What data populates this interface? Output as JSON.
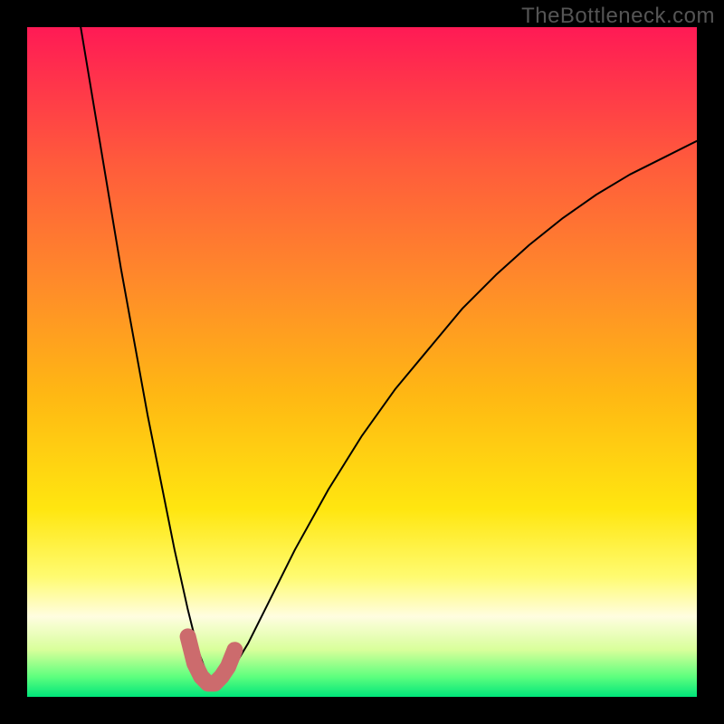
{
  "watermark": "TheBottleneck.com",
  "colors": {
    "gradient_stops": [
      {
        "offset": 0.0,
        "color": "#ff1a55"
      },
      {
        "offset": 0.2,
        "color": "#ff5a3c"
      },
      {
        "offset": 0.38,
        "color": "#ff8a2a"
      },
      {
        "offset": 0.55,
        "color": "#ffb813"
      },
      {
        "offset": 0.72,
        "color": "#ffe610"
      },
      {
        "offset": 0.82,
        "color": "#fffb70"
      },
      {
        "offset": 0.88,
        "color": "#fffde0"
      },
      {
        "offset": 0.93,
        "color": "#d8ff9a"
      },
      {
        "offset": 0.97,
        "color": "#5eff7e"
      },
      {
        "offset": 1.0,
        "color": "#00e57a"
      }
    ],
    "curve_black": "#000000",
    "curve_pink": "#cc6b6d",
    "frame_black": "#000000"
  },
  "chart_data": {
    "type": "line",
    "title": "",
    "xlabel": "",
    "ylabel": "",
    "xlim": [
      0,
      100
    ],
    "ylim": [
      0,
      100
    ],
    "note": "Axes have no tick labels in the source image; x and y are normalized 0–100. y increases upward (top = 100, bottom = 0).",
    "series": [
      {
        "name": "bottleneck-curve",
        "x": [
          8,
          10,
          12,
          14,
          16,
          18,
          20,
          22,
          24,
          25.5,
          27,
          28.5,
          30,
          33,
          36,
          40,
          45,
          50,
          55,
          60,
          65,
          70,
          75,
          80,
          85,
          90,
          95,
          100
        ],
        "y": [
          100,
          88,
          76,
          64,
          53,
          42,
          32,
          22,
          13,
          7,
          3,
          2,
          3,
          8,
          14,
          22,
          31,
          39,
          46,
          52,
          58,
          63,
          67.5,
          71.5,
          75,
          78,
          80.5,
          83
        ]
      },
      {
        "name": "safe-zone-overlay",
        "x": [
          24,
          25,
          26,
          27,
          28,
          29,
          30,
          31
        ],
        "y": [
          9,
          5,
          3,
          2,
          2,
          3,
          4.5,
          7
        ]
      }
    ]
  }
}
